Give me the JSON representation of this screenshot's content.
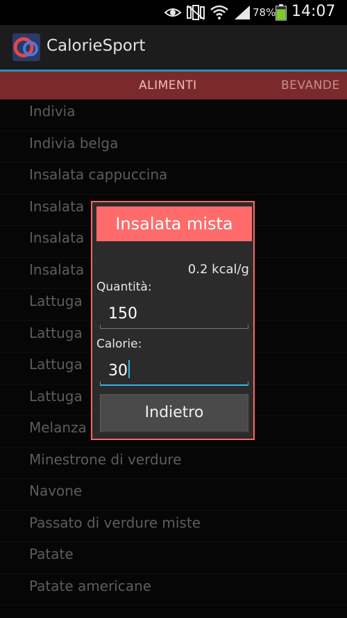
{
  "status_bar": {
    "battery_percent": "78%",
    "time": "14:07",
    "icons": [
      "eye-icon",
      "no-signal-vibrate-icon",
      "wifi-icon",
      "cell-signal-icon",
      "battery-icon"
    ]
  },
  "action_bar": {
    "title": "CalorieSport",
    "logo_icon": "calorie-sport-logo"
  },
  "tabs": [
    {
      "label": "ALIMENTI"
    },
    {
      "label": "BEVANDE"
    }
  ],
  "food_list": [
    {
      "label": "Indivia"
    },
    {
      "label": "Indivia belga"
    },
    {
      "label": "Insalata cappuccina"
    },
    {
      "label": "Insalata"
    },
    {
      "label": "Insalata"
    },
    {
      "label": "Insalata"
    },
    {
      "label": "Lattuga"
    },
    {
      "label": "Lattuga"
    },
    {
      "label": "Lattuga"
    },
    {
      "label": "Lattuga"
    },
    {
      "label": "Melanza"
    },
    {
      "label": "Minestrone di verdure"
    },
    {
      "label": "Navone"
    },
    {
      "label": "Passato di verdure miste"
    },
    {
      "label": "Patate"
    },
    {
      "label": "Patate americane"
    }
  ],
  "dialog": {
    "title": "Insalata mista",
    "rate": "0.2 kcal/g",
    "quantity_label": "Quantità:",
    "quantity_value": "150",
    "calories_label": "Calorie:",
    "calories_value": "30",
    "back_button": "Indietro"
  },
  "colors": {
    "tab_strip": "#7a2a2a",
    "dialog_accent": "#ff6b6b",
    "focus": "#33b5e5"
  }
}
